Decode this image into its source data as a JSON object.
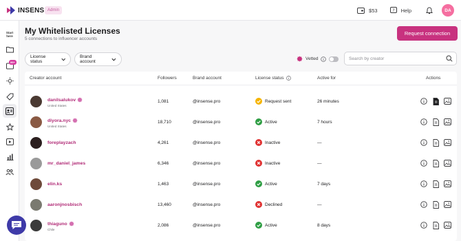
{
  "brand": {
    "name": "INSENSE",
    "admin_label": "Admin"
  },
  "topbar": {
    "balance": "$53",
    "help": "Help",
    "avatar_initials": "DA"
  },
  "sidebar": {
    "start_label_1": "Start",
    "start_label_2": "here",
    "badge": "99+"
  },
  "page": {
    "title": "My Whitelisted Licenses",
    "subtitle": "5 connections to influencer accounts",
    "request_button": "Request connection"
  },
  "filters": {
    "license_status": "License status",
    "brand_account": "Brand account",
    "vetted_label": "Vetted",
    "search_placeholder": "Search by creator"
  },
  "table": {
    "headers": {
      "creator": "Creator account",
      "followers": "Followers",
      "brand": "Brand account",
      "status": "License status",
      "active_for": "Active for",
      "actions": "Actions"
    },
    "rows": [
      {
        "name": "danilsalukov",
        "location": "United States",
        "verified": true,
        "followers": "1,081",
        "brand": "@insense.pro",
        "status": "Request sent",
        "status_type": "pending",
        "active_for": "26 minutes",
        "avatar_color": "#4a3a32"
      },
      {
        "name": "diyora.nyc",
        "location": "United States",
        "verified": true,
        "followers": "18,710",
        "brand": "@insense.pro",
        "status": "Active",
        "status_type": "active",
        "active_for": "7 hours",
        "avatar_color": "#8a5a44"
      },
      {
        "name": "foreplayzach",
        "location": "",
        "verified": false,
        "followers": "4,261",
        "brand": "@insense.pro",
        "status": "Inactive",
        "status_type": "inactive",
        "active_for": "—",
        "avatar_color": "#2b1f1f"
      },
      {
        "name": "mr_daniel_james",
        "location": "",
        "verified": false,
        "followers": "6,346",
        "brand": "@insense.pro",
        "status": "Inactive",
        "status_type": "inactive",
        "active_for": "—",
        "avatar_color": "#9a9a9a"
      },
      {
        "name": "elin.ks",
        "location": "",
        "verified": false,
        "followers": "1,463",
        "brand": "@insense.pro",
        "status": "Active",
        "status_type": "active",
        "active_for": "7 days",
        "avatar_color": "#6e4a3a"
      },
      {
        "name": "aaronjnosbisch",
        "location": "",
        "verified": false,
        "followers": "13,460",
        "brand": "@insense.pro",
        "status": "Declined",
        "status_type": "inactive",
        "active_for": "—",
        "avatar_color": "#7a7a70"
      },
      {
        "name": "thiaguno",
        "location": "Chile",
        "verified": true,
        "followers": "2,086",
        "brand": "@insense.pro",
        "status": "Active",
        "status_type": "active",
        "active_for": "8 days",
        "avatar_color": "#3a3a3a"
      }
    ]
  },
  "colors": {
    "accent": "#c8327f",
    "active": "#2f9e44",
    "inactive": "#e03131",
    "pending": "#f5b400",
    "chat": "#3e3aa8"
  }
}
